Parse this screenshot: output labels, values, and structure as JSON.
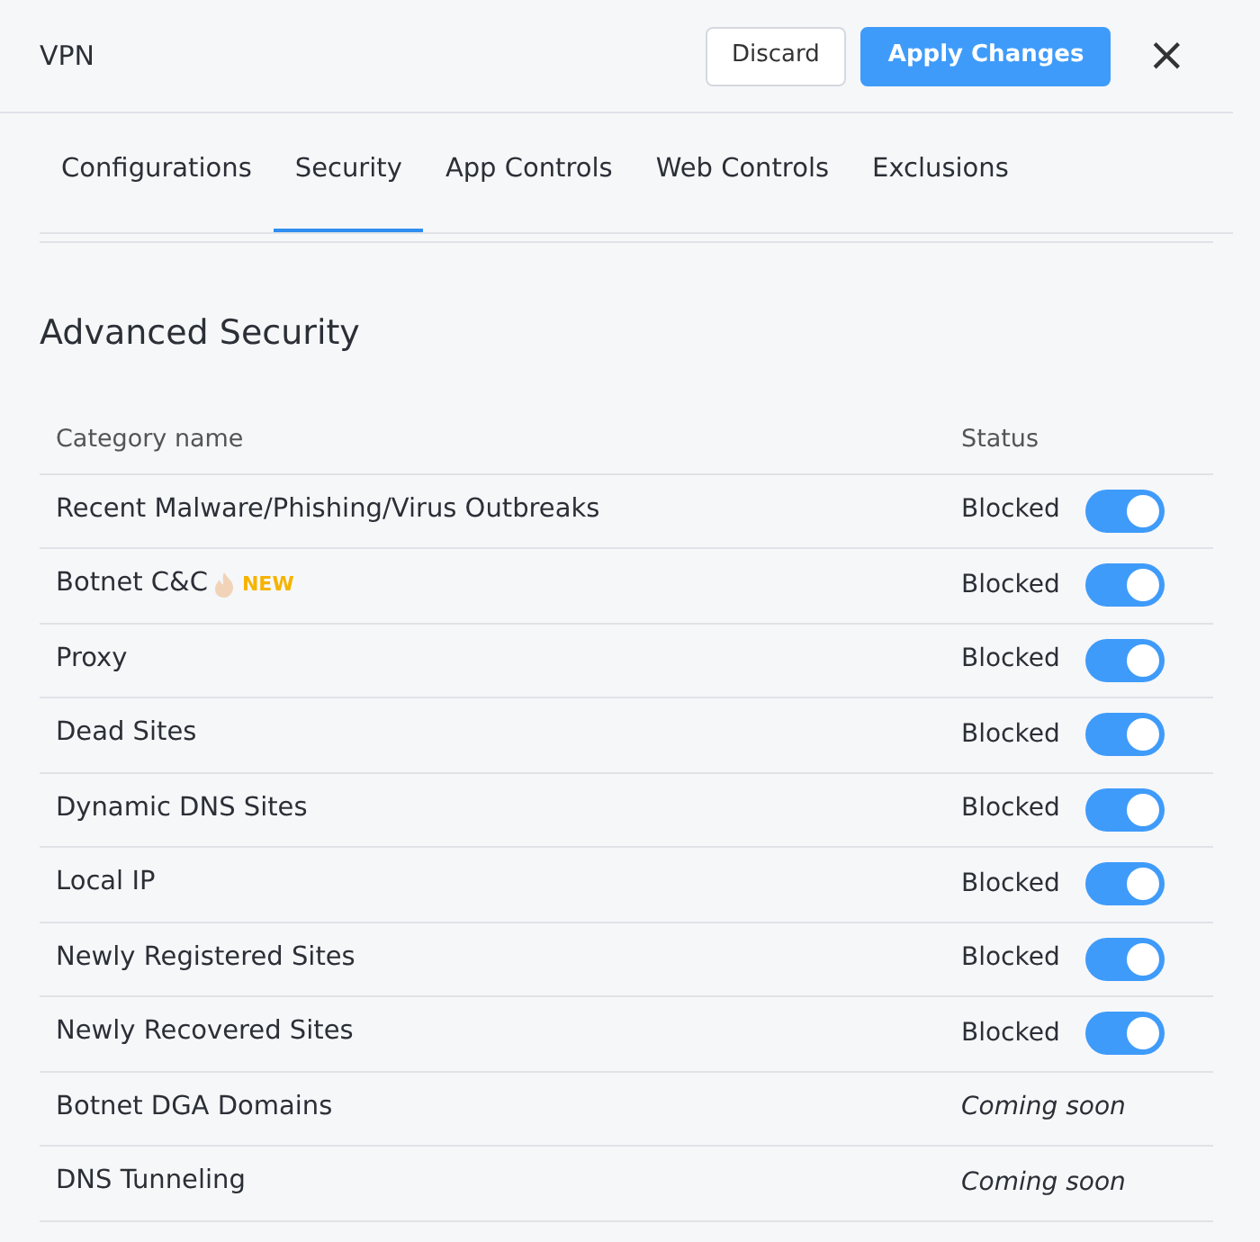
{
  "window": {
    "title": "VPN"
  },
  "buttons": [
    {
      "label": "Discard",
      "kind": "secondary"
    },
    {
      "label": "Apply Changes",
      "kind": "primary"
    }
  ],
  "close": {
    "label": "×"
  },
  "tabs": [
    {
      "label": "Configurations",
      "selected": false
    },
    {
      "label": "Security",
      "selected": true
    },
    {
      "label": "App Controls",
      "selected": false
    },
    {
      "label": "Web Controls",
      "selected": false
    },
    {
      "label": "Exclusions",
      "selected": false
    }
  ],
  "section": {
    "title": "Advanced Security"
  },
  "table": {
    "columns": [
      "Category name",
      "Status"
    ],
    "rows": [
      {
        "name": "Recent Malware/Phishing/Virus Outbreaks",
        "kind": "toggle",
        "status": "Blocked",
        "on": true
      },
      {
        "name": "Botnet C&C",
        "badge": "NEW",
        "kind": "toggle",
        "status": "Blocked",
        "on": true
      },
      {
        "name": "Proxy",
        "kind": "toggle",
        "status": "Blocked",
        "on": true
      },
      {
        "name": "Dead Sites",
        "kind": "toggle",
        "status": "Blocked",
        "on": true
      },
      {
        "name": "Dynamic DNS Sites",
        "kind": "toggle",
        "status": "Blocked",
        "on": true
      },
      {
        "name": "Local IP",
        "kind": "toggle",
        "status": "Blocked",
        "on": true
      },
      {
        "name": "Newly Registered Sites",
        "kind": "toggle",
        "status": "Blocked",
        "on": true
      },
      {
        "name": "Newly Recovered Sites",
        "kind": "toggle",
        "status": "Blocked",
        "on": true
      },
      {
        "name": "Botnet DGA Domains",
        "kind": "note",
        "status": "Coming soon"
      },
      {
        "name": "DNS Tunneling",
        "kind": "note",
        "status": "Coming soon"
      }
    ]
  }
}
